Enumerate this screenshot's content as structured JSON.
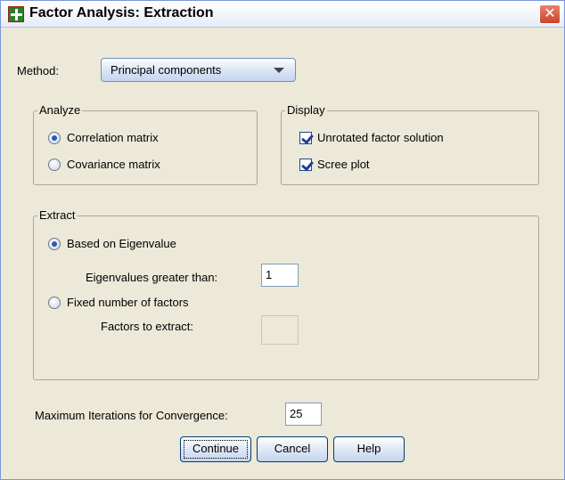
{
  "window": {
    "title": "Factor Analysis: Extraction",
    "close_glyph": "✕"
  },
  "method": {
    "label": "Method:",
    "selected": "Principal components"
  },
  "analyze": {
    "legend": "Analyze",
    "options": [
      {
        "label": "Correlation matrix",
        "checked": true
      },
      {
        "label": "Covariance matrix",
        "checked": false
      }
    ]
  },
  "display": {
    "legend": "Display",
    "options": [
      {
        "label": "Unrotated factor solution",
        "checked": true
      },
      {
        "label": "Scree plot",
        "checked": true
      }
    ]
  },
  "extract": {
    "legend": "Extract",
    "eigen_radio": "Based on Eigenvalue",
    "eigen_label": "Eigenvalues greater than:",
    "eigen_value": "1",
    "fixed_radio": "Fixed number of factors",
    "factors_label": "Factors to extract:",
    "factors_value": "",
    "selected": "eigenvalue"
  },
  "iterations": {
    "label": "Maximum Iterations for Convergence:",
    "value": "25"
  },
  "buttons": {
    "continue": "Continue",
    "cancel": "Cancel",
    "help": "Help"
  },
  "icons": {
    "app": "spss-dialog-icon",
    "close": "close-icon",
    "dropdown": "chevron-down-icon"
  },
  "colors": {
    "dialog_bg": "#ece9d8",
    "radio_dot": "#2a59b8",
    "check": "#1f3e96"
  }
}
